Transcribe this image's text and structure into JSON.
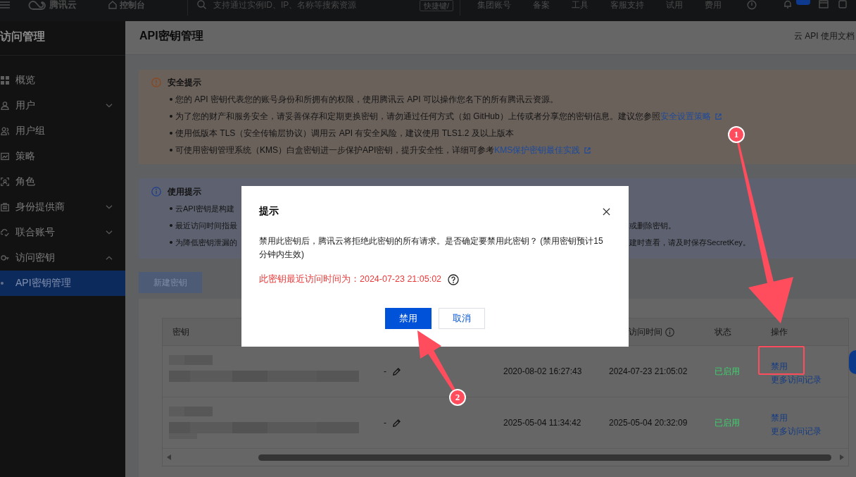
{
  "top_bar": {
    "brand": "腾讯云",
    "console": "控制台",
    "search": {
      "placeholder": "支持通过实例ID、IP、名称等搜索资源"
    },
    "shortcut": "快捷键/",
    "links": [
      "集团账号",
      "备案",
      "工具",
      "客服支持",
      "试用",
      "费用"
    ]
  },
  "sidebar": {
    "title": "访问管理",
    "items": [
      {
        "label": "概览",
        "kind": "page",
        "selected": false
      },
      {
        "label": "用户",
        "kind": "group",
        "expanded": false,
        "selected": false
      },
      {
        "label": "用户组",
        "kind": "page",
        "selected": false
      },
      {
        "label": "策略",
        "kind": "page",
        "selected": false
      },
      {
        "label": "角色",
        "kind": "page",
        "selected": false
      },
      {
        "label": "身份提供商",
        "kind": "group",
        "expanded": false,
        "selected": false
      },
      {
        "label": "联合账号",
        "kind": "group",
        "expanded": false,
        "selected": false
      },
      {
        "label": "访问密钥",
        "kind": "group",
        "expanded": true,
        "selected": false,
        "children": [
          {
            "label": "API密钥管理",
            "selected": true
          }
        ]
      }
    ]
  },
  "page": {
    "title": "API密钥管理",
    "doc_link": "云 API 使用文档"
  },
  "security_notice": {
    "title": "安全提示",
    "items": [
      {
        "text": "您的 API 密钥代表您的账号身份和所拥有的权限，使用腾讯云 API 可以操作您名下的所有腾讯云资源。"
      },
      {
        "text": "为了您的财产和服务安全，请妥善保存和定期更换密钥，请勿通过任何方式（如 GitHub）上传或者分享您的密钥信息。建议您参照",
        "link": "安全设置策略"
      },
      {
        "text": "使用低版本 TLS（安全传输层协议）调用云 API 有安全风险，建议使用 TLS1.2 及以上版本"
      },
      {
        "text": "可使用密钥管理系统（KMS）白盒密钥进一步保护API密钥，提升安全性，详细可参考",
        "link": "KMS保护密钥最佳实践"
      }
    ]
  },
  "usage_notice": {
    "title": "使用提示",
    "items": [
      {
        "start": "云API密钥是构建"
      },
      {
        "start": "最近访问时间指最",
        "end": "或删除密钥。"
      },
      {
        "start": "为降低密钥泄漏的",
        "end": "建时查看，请及时保存SecretKey。"
      }
    ]
  },
  "create_button": {
    "label": "新建密钥",
    "disabled": true
  },
  "table": {
    "columns": {
      "key": "密钥",
      "last_access": "访问时间",
      "status": "状态",
      "actions": "操作"
    },
    "rows": [
      {
        "remark": "-",
        "created": "2020-08-02 16:27:43",
        "last_access": "2024-07-23 21:05:02",
        "status": "已启用",
        "actions": [
          {
            "label": "禁用",
            "highlighted": true
          },
          {
            "label": "更多访问记录",
            "highlighted": false
          }
        ]
      },
      {
        "remark": "-",
        "created": "2025-05-04 11:34:42",
        "last_access": "2025-05-04 20:32:09",
        "status": "已启用",
        "actions": [
          {
            "label": "禁用",
            "highlighted": false
          },
          {
            "label": "更多访问记录",
            "highlighted": false
          }
        ]
      }
    ]
  },
  "dialog": {
    "title": "提示",
    "message": "禁用此密钥后，腾讯云将拒绝此密钥的所有请求。是否确定要禁用此密钥？ (禁用密钥预计15分钟内生效)",
    "warning": "此密钥最近访问时间为：2024-07-23 21:05:02",
    "buttons": [
      {
        "label": "禁用",
        "kind": "primary"
      },
      {
        "label": "取消",
        "kind": "secondary"
      }
    ]
  },
  "callouts": [
    "1",
    "2"
  ]
}
